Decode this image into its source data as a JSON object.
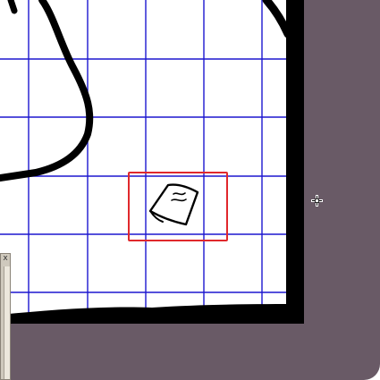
{
  "map": {
    "grid_color": "#1d17cf",
    "wall_color": "#000000",
    "background_color": "#ffffff",
    "backdrop_color": "#695a66",
    "selection_color": "#e0282c",
    "selected_item_icon": "note-scroll-icon"
  },
  "side_panel": {
    "close_label": "x"
  },
  "cursor": {
    "icon": "move-crosshair-icon"
  }
}
